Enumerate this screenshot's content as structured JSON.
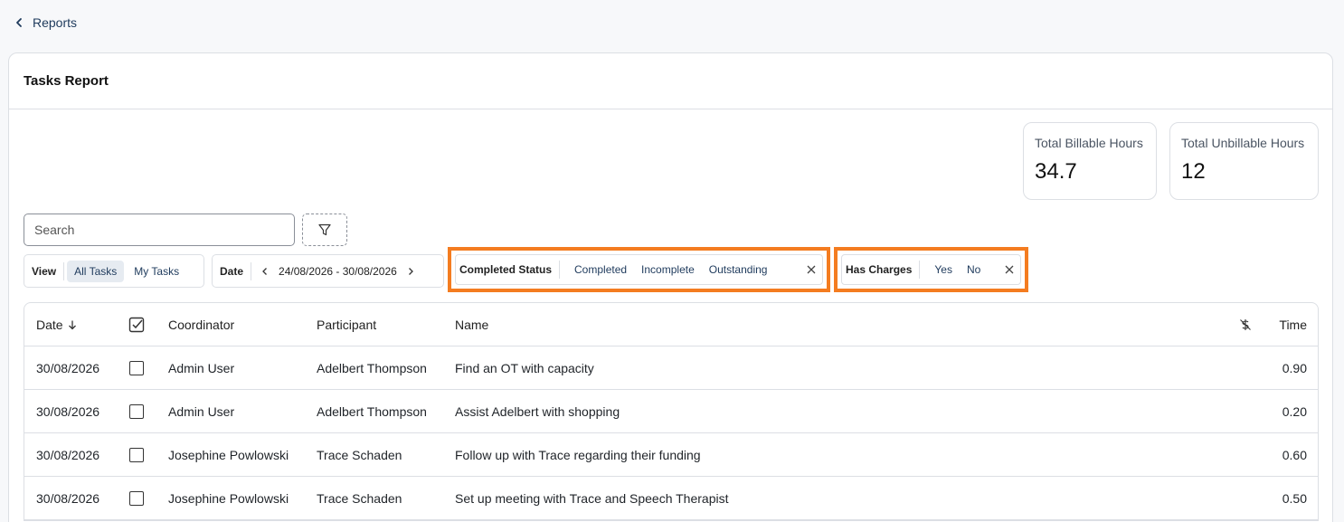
{
  "nav": {
    "back_label": "Reports"
  },
  "page": {
    "title": "Tasks Report"
  },
  "stats": [
    {
      "label": "Total Billable Hours",
      "value": "34.7"
    },
    {
      "label": "Total Unbillable Hours",
      "value": "12"
    }
  ],
  "search": {
    "placeholder": "Search"
  },
  "view": {
    "label": "View",
    "options": [
      "All Tasks",
      "My Tasks"
    ],
    "selected": "All Tasks"
  },
  "date": {
    "label": "Date",
    "range": "24/08/2026 - 30/08/2026"
  },
  "filters": {
    "completed_status": {
      "label": "Completed Status",
      "options": [
        "Completed",
        "Incomplete",
        "Outstanding"
      ]
    },
    "has_charges": {
      "label": "Has Charges",
      "options": [
        "Yes",
        "No"
      ]
    }
  },
  "table": {
    "columns": {
      "date": "Date",
      "coordinator": "Coordinator",
      "participant": "Participant",
      "name": "Name",
      "time": "Time"
    },
    "rows": [
      {
        "date": "30/08/2026",
        "coordinator": "Admin User",
        "participant": "Adelbert Thompson",
        "name": "Find an OT with capacity",
        "time": "0.90"
      },
      {
        "date": "30/08/2026",
        "coordinator": "Admin User",
        "participant": "Adelbert Thompson",
        "name": "Assist Adelbert with shopping",
        "time": "0.20"
      },
      {
        "date": "30/08/2026",
        "coordinator": "Josephine Powlowski",
        "participant": "Trace Schaden",
        "name": "Follow up with Trace regarding their funding",
        "time": "0.60"
      },
      {
        "date": "30/08/2026",
        "coordinator": "Josephine Powlowski",
        "participant": "Trace Schaden",
        "name": "Set up meeting with Trace and Speech Therapist",
        "time": "0.50"
      }
    ]
  }
}
